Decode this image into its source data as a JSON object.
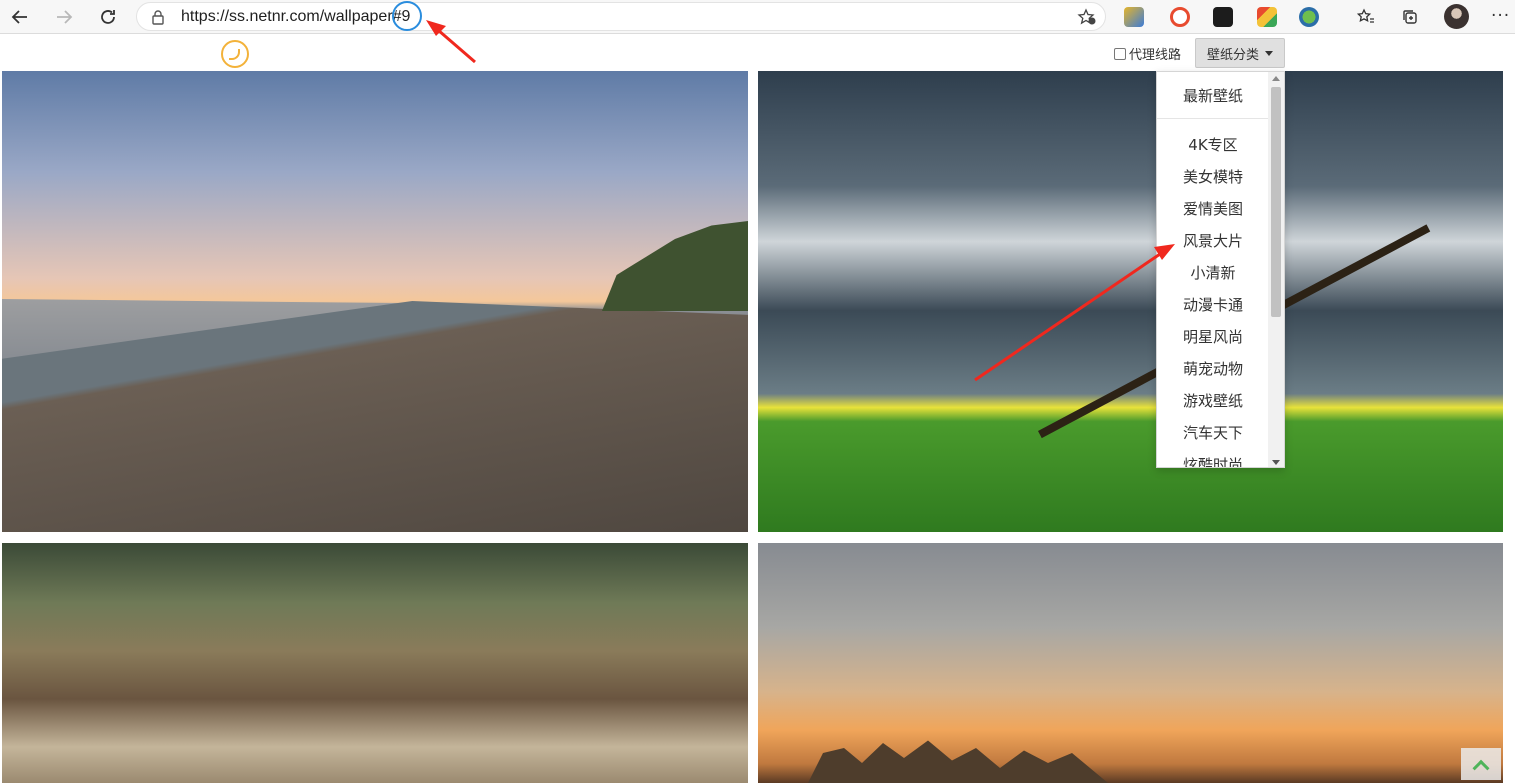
{
  "browser": {
    "url_host": "https://ss.netnr.com/wallpaper",
    "url_hash": "#9"
  },
  "page": {
    "proxy_label": "代理线路",
    "category_button": "壁纸分类"
  },
  "menu": {
    "latest": "最新壁纸",
    "items": [
      "4K专区",
      "美女模特",
      "爱情美图",
      "风景大片",
      "小清新",
      "动漫卡通",
      "明星风尚",
      "萌宠动物",
      "游戏壁纸",
      "汽车天下",
      "炫酷时尚"
    ]
  },
  "colors": {
    "annotation_arrow": "#f0281e",
    "highlight_circle": "#2a8dde",
    "logo": "#f3b23a"
  }
}
